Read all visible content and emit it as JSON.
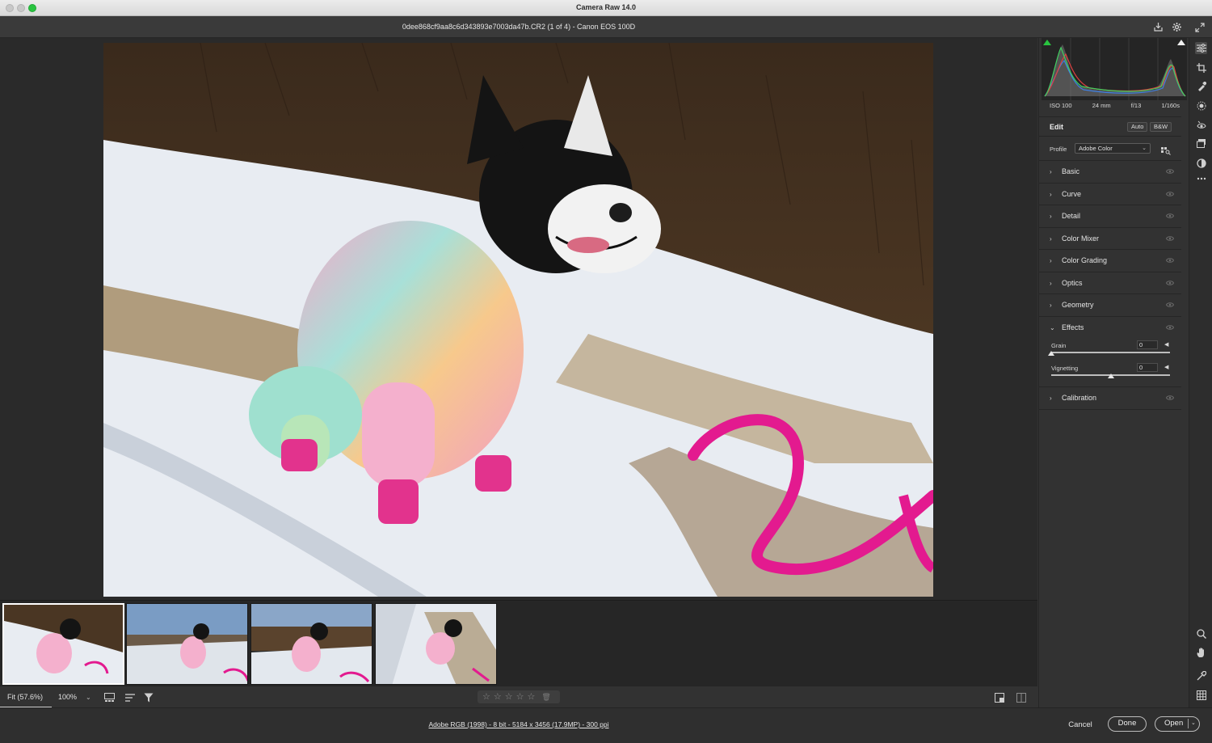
{
  "window": {
    "title": "Camera Raw 14.0"
  },
  "file": {
    "info": "0dee868cf9aa8c6d343893e7003da47b.CR2 (1 of 4)  -  Canon EOS 100D"
  },
  "camera_info": {
    "iso": "ISO 100",
    "focal": "24 mm",
    "aperture": "f/13",
    "shutter": "1/160s"
  },
  "edit": {
    "title": "Edit",
    "auto_label": "Auto",
    "bw_label": "B&W"
  },
  "profile": {
    "label": "Profile",
    "value": "Adobe Color"
  },
  "sections": {
    "basic": "Basic",
    "curve": "Curve",
    "detail": "Detail",
    "color_mixer": "Color Mixer",
    "color_grading": "Color Grading",
    "optics": "Optics",
    "geometry": "Geometry",
    "effects": "Effects",
    "calibration": "Calibration"
  },
  "effects": {
    "grain": {
      "label": "Grain",
      "value": "0",
      "position": 0
    },
    "vignetting": {
      "label": "Vignetting",
      "value": "0",
      "position": 0.5
    }
  },
  "toolbar": {
    "zoom_fit": "Fit (57.6%)",
    "zoom_100": "100%"
  },
  "rating": {
    "stars": 0,
    "max": 5
  },
  "status": {
    "workflow": "Adobe RGB (1998) - 8 bit - 5184 x 3456 (17.9MP) - 300 ppi",
    "cancel": "Cancel",
    "done": "Done",
    "open": "Open"
  },
  "filmstrip": {
    "selected_index": 0,
    "count": 4
  },
  "colors": {
    "accent_green": "#29c440",
    "panel": "#323232",
    "canvas": "#2a2a2a"
  }
}
